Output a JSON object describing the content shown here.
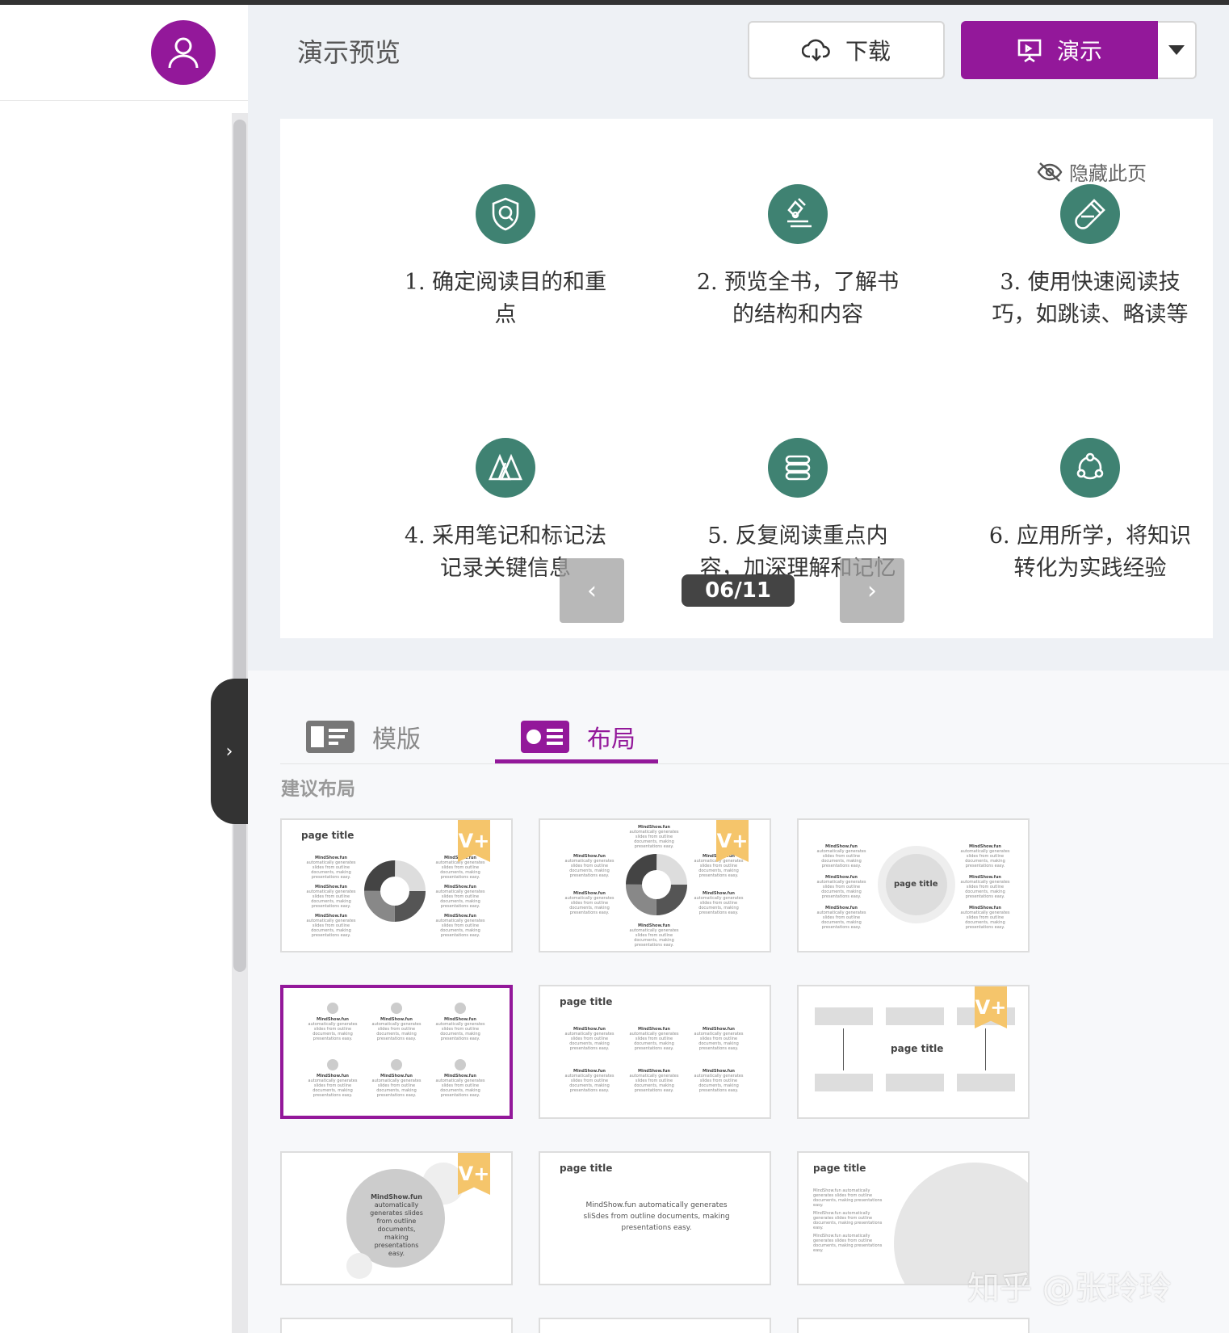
{
  "header": {
    "title": "演示预览",
    "download_label": "下载",
    "present_label": "演示"
  },
  "slide": {
    "hide_page_label": "隐藏此页",
    "counter": "06/11",
    "items": [
      {
        "label": "1. 确定阅读目的和重点",
        "icon": "shield-icon"
      },
      {
        "label": "2. 预览全书，了解书的结构和内容",
        "icon": "microscope-icon"
      },
      {
        "label": "3. 使用快速阅读技巧，如跳读、略读等",
        "icon": "flask-icon"
      },
      {
        "label": "4. 采用笔记和标记法记录关键信息",
        "icon": "triangles-icon"
      },
      {
        "label": "5. 反复阅读重点内容，加深理解和记忆",
        "icon": "stack-icon"
      },
      {
        "label": "6. 应用所学，将知识转化为实践经验",
        "icon": "network-icon"
      }
    ]
  },
  "tabs": {
    "template": "模版",
    "layout": "布局"
  },
  "section_label": "建议布局",
  "thumbs": {
    "page_title": "page title",
    "brand": "MindShow.fun",
    "blurb": "automatically generates slides from outline documents, making presentations easy.",
    "center_text": "MindShow.fun automatically generates sliSdes from outline documents, making presentations easy.",
    "badge": "V+"
  },
  "watermark": "知乎 @张玲玲",
  "colors": {
    "brand": "#93189a",
    "icon_green": "#3f8272",
    "badge": "#f5c56b"
  }
}
